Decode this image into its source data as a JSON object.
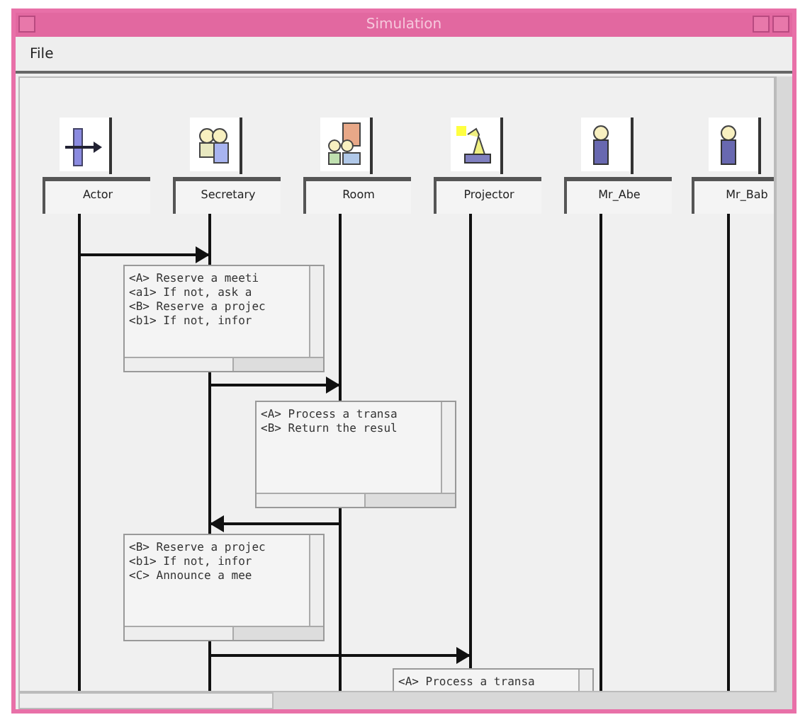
{
  "window": {
    "title": "Simulation"
  },
  "menu": [
    "File"
  ],
  "lifelines": [
    {
      "label": "Actor",
      "kind": "actor"
    },
    {
      "label": "Secretary",
      "kind": "group"
    },
    {
      "label": "Room",
      "kind": "room"
    },
    {
      "label": "Projector",
      "kind": "projector"
    },
    {
      "label": "Mr_Abe",
      "kind": "person"
    },
    {
      "label": "Mr_Bab",
      "kind": "person"
    }
  ],
  "steps": [
    {
      "kind": "right_arrow",
      "note": [
        "<A> Reserve a meeti",
        "<a1> If not, ask a",
        "<B> Reserve a projec",
        "<b1> If not, infor"
      ]
    },
    {
      "kind": "right_arrow",
      "note": [
        "<A> Process a transa",
        "<B> Return the resul"
      ]
    },
    {
      "kind": "left_arrow",
      "note": [
        "<B> Reserve a projec",
        "<b1> If not, infor",
        "<C> Announce a mee"
      ]
    },
    {
      "kind": "right_arrow",
      "note": [
        "<A> Process a transa"
      ]
    }
  ]
}
